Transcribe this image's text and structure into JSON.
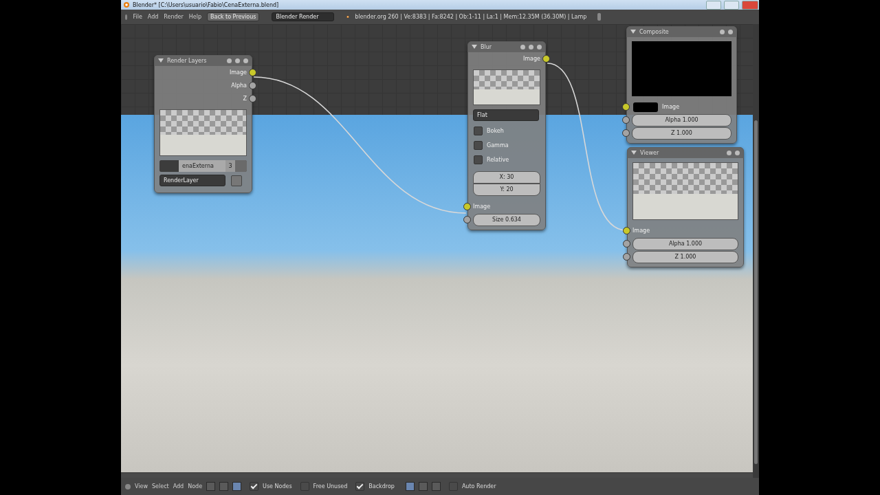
{
  "window": {
    "title": "Blender* [C:\\Users\\usuario\\Fabio\\CenaExterna.blend]"
  },
  "header": {
    "menus": [
      "File",
      "Add",
      "Render",
      "Help"
    ],
    "back_button": "Back to Previous",
    "engine": "Blender Render",
    "info": "blender.org 260 | Ve:8383 | Fa:8242 | Ob:1-11 | La:1 | Mem:12.35M (36.30M) | Lamp"
  },
  "render_layers": {
    "title": "Render Layers",
    "outputs": [
      {
        "label": "Image",
        "kind": "image"
      },
      {
        "label": "Alpha",
        "kind": "value"
      },
      {
        "label": "Z",
        "kind": "value"
      }
    ],
    "scene_field": "enaExterna",
    "users": "3",
    "layer_dropdown": "RenderLayer"
  },
  "blur": {
    "title": "Blur",
    "outputs": [
      {
        "label": "Image",
        "kind": "image"
      }
    ],
    "filter": "Flat",
    "options": [
      {
        "label": "Bokeh",
        "checked": false
      },
      {
        "label": "Gamma",
        "checked": false
      },
      {
        "label": "Relative",
        "checked": false
      }
    ],
    "x_field": "X: 30",
    "y_field": "Y: 20",
    "inputs": [
      {
        "label": "Image",
        "kind": "image"
      }
    ],
    "size_field": "Size 0.634"
  },
  "composite": {
    "title": "Composite",
    "image_input": "Image",
    "fields": [
      {
        "label": "Alpha 1.000",
        "kind": "value"
      },
      {
        "label": "Z 1.000",
        "kind": "value"
      }
    ]
  },
  "viewer": {
    "title": "Viewer",
    "image_input": "Image",
    "fields": [
      {
        "label": "Alpha 1.000",
        "kind": "value"
      },
      {
        "label": "Z 1.000",
        "kind": "value"
      }
    ]
  },
  "footer": {
    "menus": [
      "View",
      "Select",
      "Add",
      "Node"
    ],
    "toggles": [
      {
        "label": "Use Nodes",
        "checked": true
      },
      {
        "label": "Free Unused",
        "checked": false
      },
      {
        "label": "Backdrop",
        "checked": true
      },
      {
        "label": "Auto Render",
        "checked": false
      }
    ]
  }
}
